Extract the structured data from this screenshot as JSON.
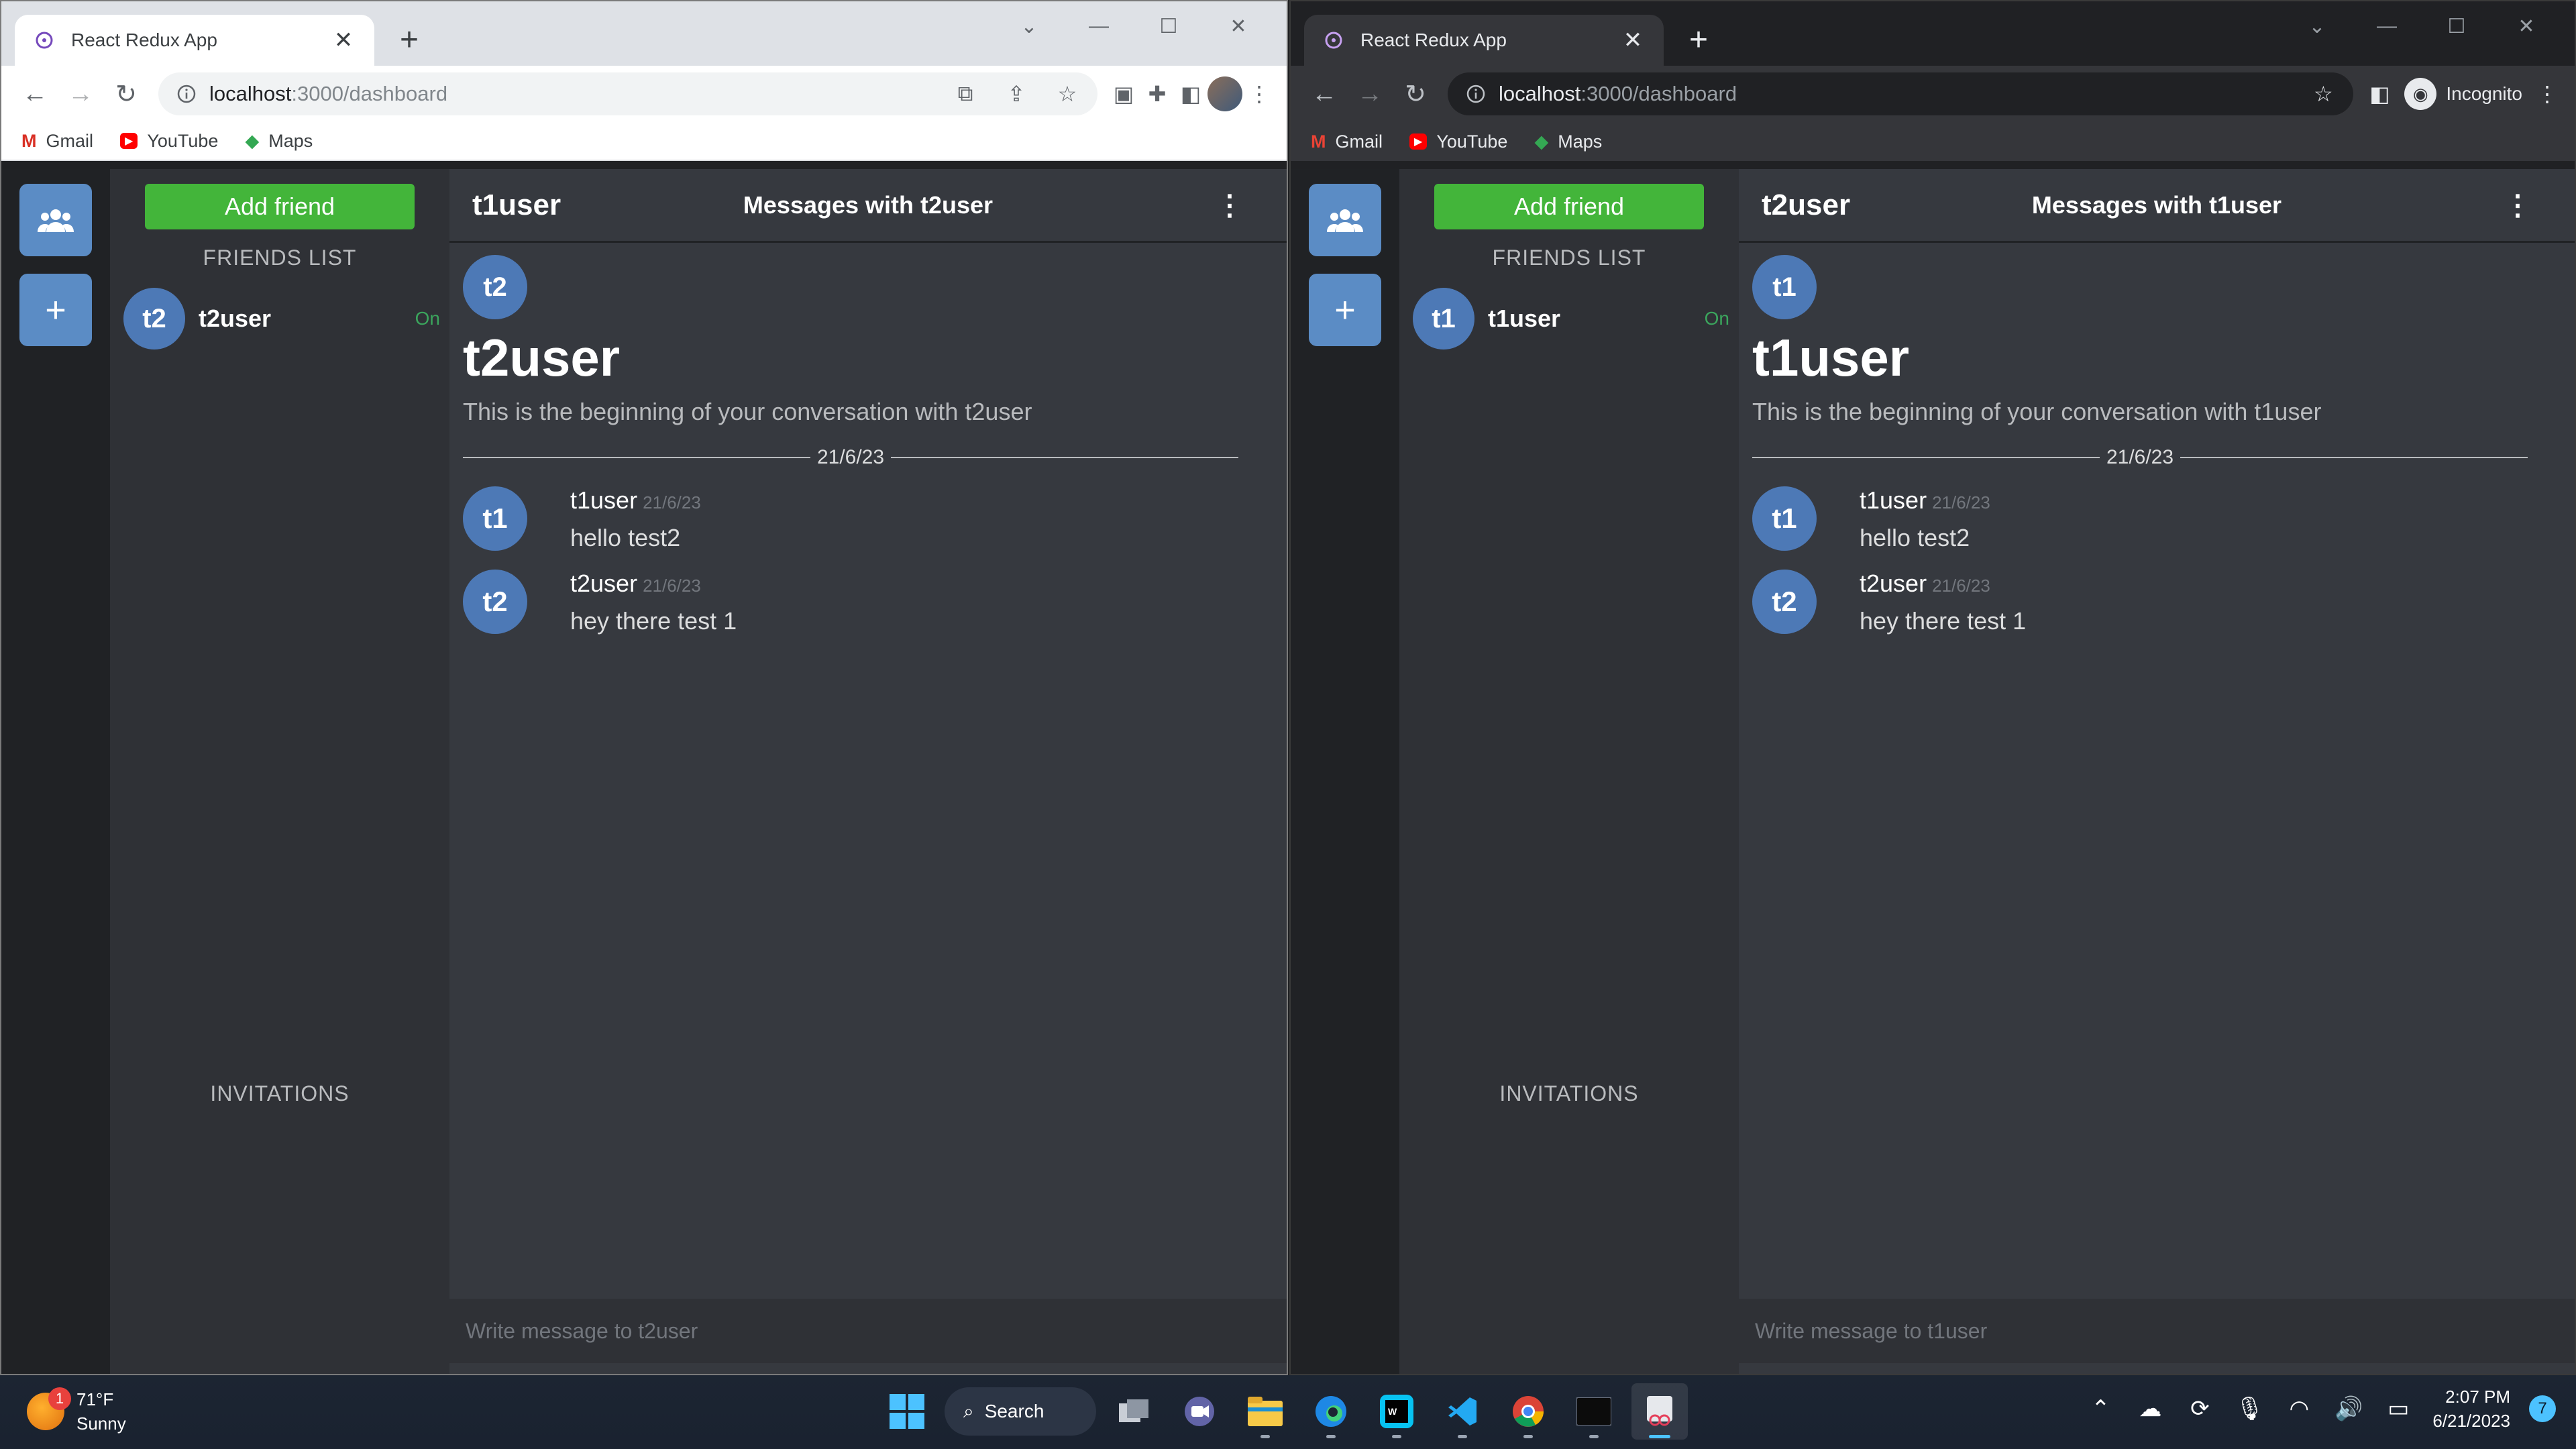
{
  "browsers": {
    "left": {
      "tab_title": "React Redux App",
      "url_host": "localhost",
      "url_path": ":3000/dashboard",
      "bookmarks": [
        "Gmail",
        "YouTube",
        "Maps"
      ]
    },
    "right": {
      "tab_title": "React Redux App",
      "url_host": "localhost",
      "url_path": ":3000/dashboard",
      "incognito_label": "Incognito",
      "bookmarks": [
        "Gmail",
        "YouTube",
        "Maps"
      ]
    }
  },
  "apps": {
    "left": {
      "add_friend": "Add friend",
      "friends_title": "FRIENDS LIST",
      "friend": {
        "initials": "t2",
        "name": "t2user",
        "status": "On"
      },
      "invitations_title": "INVITATIONS",
      "me": "t1user",
      "chat_title": "Messages with t2user",
      "intro": {
        "initials": "t2",
        "name": "t2user",
        "text": "This is the beginning of your conversation with t2user"
      },
      "date": "21/6/23",
      "messages": [
        {
          "initials": "t1",
          "author": "t1user",
          "date": "21/6/23",
          "text": "hello test2"
        },
        {
          "initials": "t2",
          "author": "t2user",
          "date": "21/6/23",
          "text": "hey there test 1"
        }
      ],
      "compose_placeholder": "Write message to t2user"
    },
    "right": {
      "add_friend": "Add friend",
      "friends_title": "FRIENDS LIST",
      "friend": {
        "initials": "t1",
        "name": "t1user",
        "status": "On"
      },
      "invitations_title": "INVITATIONS",
      "me": "t2user",
      "chat_title": "Messages with t1user",
      "intro": {
        "initials": "t1",
        "name": "t1user",
        "text": "This is the beginning of your conversation with t1user"
      },
      "date": "21/6/23",
      "messages": [
        {
          "initials": "t1",
          "author": "t1user",
          "date": "21/6/23",
          "text": "hello test2"
        },
        {
          "initials": "t2",
          "author": "t2user",
          "date": "21/6/23",
          "text": "hey there test 1"
        }
      ],
      "compose_placeholder": "Write message to t1user"
    }
  },
  "taskbar": {
    "weather_temp": "71°F",
    "weather_cond": "Sunny",
    "weather_badge": "1",
    "search_label": "Search",
    "time": "2:07 PM",
    "date": "6/21/2023",
    "notification_count": "7"
  },
  "colors": {
    "accent_green": "#43b53a",
    "avatar_blue": "#4d79b6",
    "online_green": "#3ba55d"
  }
}
